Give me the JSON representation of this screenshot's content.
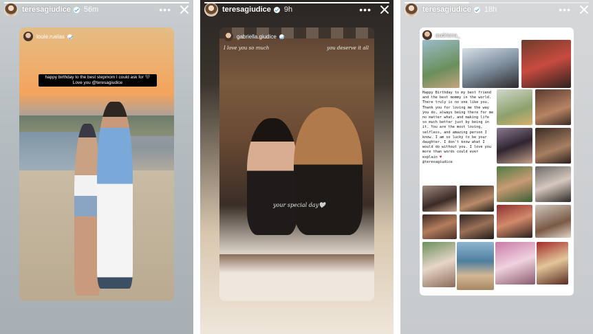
{
  "stories": [
    {
      "username": "teresagiudice",
      "time": "56m",
      "progress": 1.0,
      "embedded_user": "louie.ruelas",
      "caption": "happy birthday to the best stepmom I could ask for 🖤 Love you @teresagiudice"
    },
    {
      "username": "teresagiudice",
      "time": "9h",
      "progress": 1.0,
      "embedded_user": "gabriella.giudice",
      "script_left": "I love you so much",
      "script_right": "you deserve it all",
      "script_center": "your special day🤍"
    },
    {
      "username": "teresagiudice",
      "time": "18h",
      "progress": 0.35,
      "embedded_user": "audriana_",
      "message": "Happy Birthday to my best friend and the best mommy in the world. There truly is no one like you. Thank you for loving me the way you do, always being there for me no matter what, and making life so much better just by being in it. You are the most loving, selfless, and amazing person I know. I am so lucky to be your daughter. I don't know what I would do without you. I love you more than words could ever explain",
      "heart": "♥",
      "mention": "@teresagiudice"
    }
  ],
  "controls": {
    "more_label": "•••"
  }
}
